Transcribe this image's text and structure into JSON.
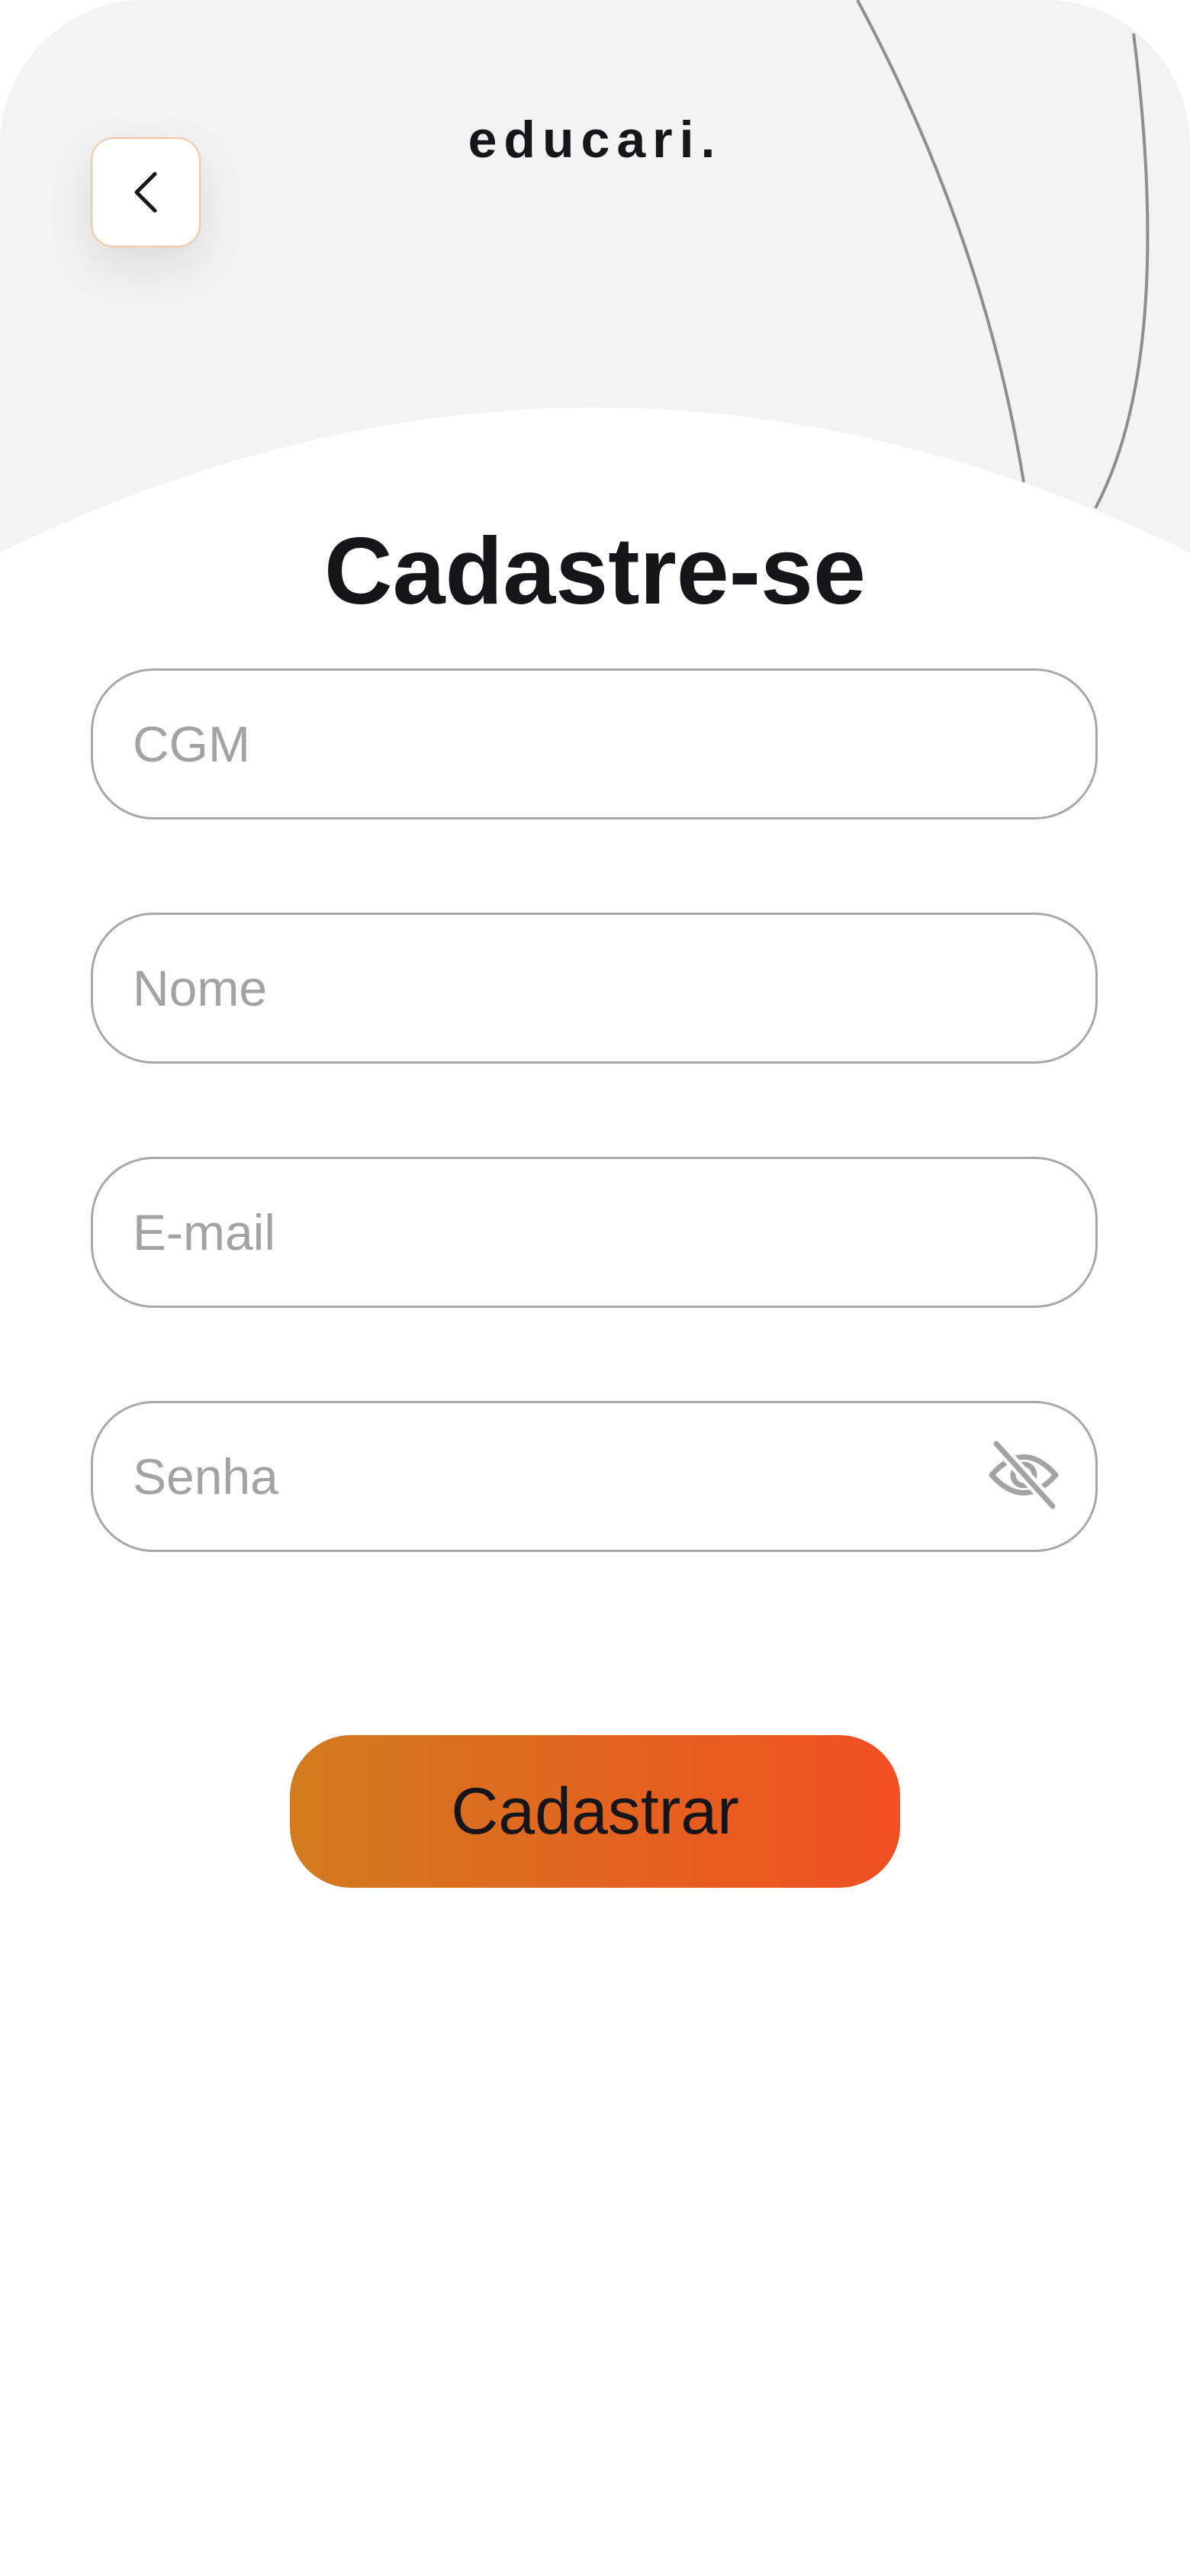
{
  "app": {
    "logo": "educari."
  },
  "header": {
    "back_icon": "chevron-left-icon",
    "title": "Cadastre-se"
  },
  "form": {
    "cgm": {
      "placeholder": "CGM",
      "value": ""
    },
    "nome": {
      "placeholder": "Nome",
      "value": ""
    },
    "email": {
      "placeholder": "E-mail",
      "value": ""
    },
    "senha": {
      "placeholder": "Senha",
      "value": "",
      "toggle_icon": "eye-off-icon"
    },
    "submit_label": "Cadastrar"
  },
  "colors": {
    "header_background": "#f3f3f3",
    "accent_start": "#d27b1f",
    "accent_end": "#f24f22",
    "text_primary": "#16161a",
    "placeholder": "#a3a3a3",
    "field_border": "#a8a8a8"
  }
}
